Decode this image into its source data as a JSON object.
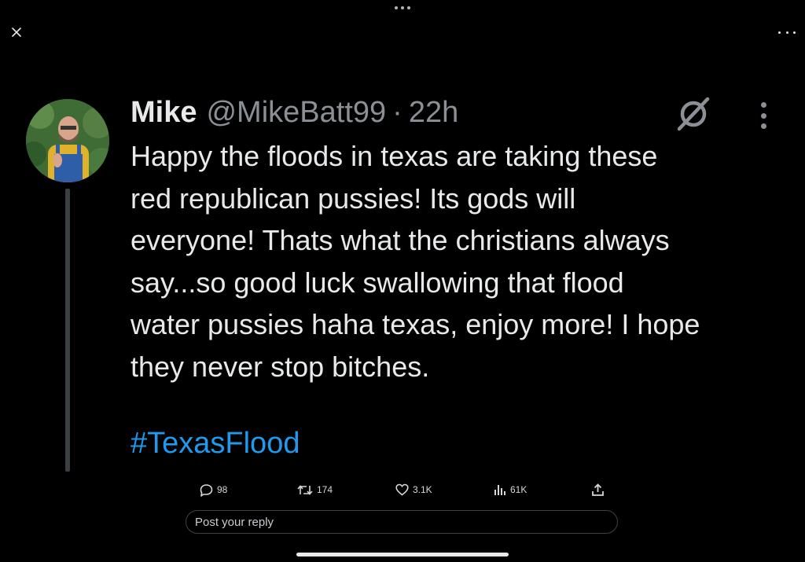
{
  "tweet": {
    "display_name": "Mike",
    "handle": "@MikeBatt99",
    "separator": "·",
    "time": "22h",
    "text_lines": [
      "Happy the floods in texas are taking these",
      "red republican pussies! Its gods will",
      "everyone! Thats what the christians always",
      "say...so good luck swallowing that flood",
      "water pussies haha texas, enjoy more! I hope",
      "they never stop bitches."
    ],
    "hashtag": "#TexasFlood"
  },
  "actions": {
    "replies": "98",
    "reposts": "174",
    "likes": "3.1K",
    "views": "61K"
  },
  "reply_box": {
    "placeholder": "Post your reply"
  },
  "icons": {
    "close": "close-icon",
    "more": "more-horizontal-icon",
    "grok": "grok-icon",
    "tweet_more": "more-vertical-icon",
    "reply": "reply-icon",
    "repost": "repost-icon",
    "like": "heart-icon",
    "views": "views-icon",
    "share": "share-icon"
  },
  "colors": {
    "background": "#000000",
    "text": "#e7e9ea",
    "secondary": "#8b9096",
    "link": "#1d9bf0"
  }
}
